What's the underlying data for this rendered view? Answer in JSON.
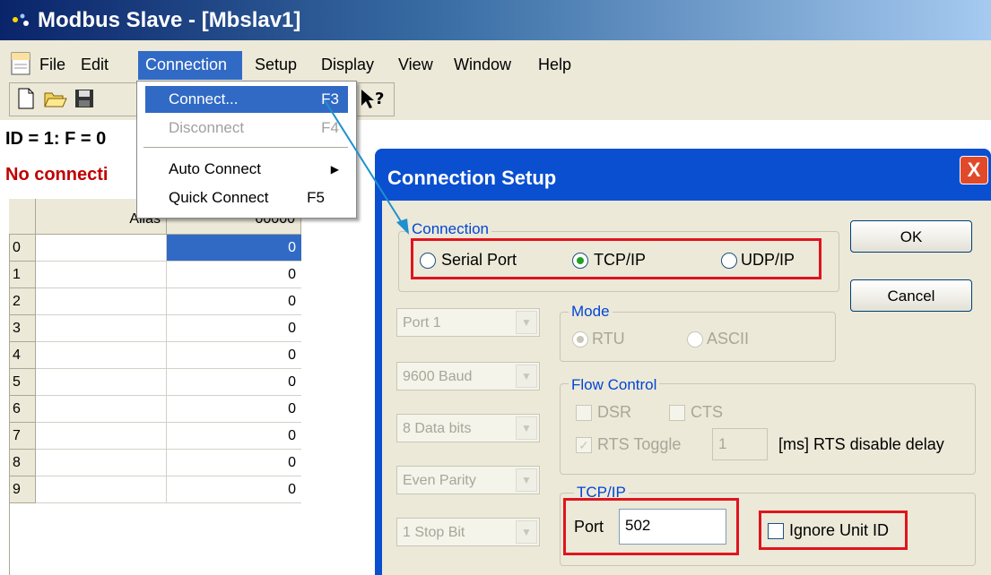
{
  "window": {
    "title": "Modbus Slave - [Mbslav1]"
  },
  "menubar": {
    "items": [
      "File",
      "Edit",
      "Connection",
      "Setup",
      "Display",
      "View",
      "Window",
      "Help"
    ]
  },
  "connection_menu": [
    {
      "label": "Connect...",
      "shortcut": "F3"
    },
    {
      "label": "Disconnect",
      "shortcut": "F4"
    },
    {
      "label": "Auto Connect",
      "shortcut": ""
    },
    {
      "label": "Quick Connect",
      "shortcut": "F5"
    }
  ],
  "status": {
    "id_line": "ID = 1: F = 0",
    "no_connection": "No connecti"
  },
  "grid": {
    "col_a_header": "Alias",
    "col_b_header": "00000",
    "row_numbers": [
      "0",
      "1",
      "2",
      "3",
      "4",
      "5",
      "6",
      "7",
      "8",
      "9"
    ],
    "values": [
      "0",
      "0",
      "0",
      "0",
      "0",
      "0",
      "0",
      "0",
      "0",
      "0"
    ]
  },
  "dialog": {
    "title": "Connection Setup",
    "close": "X",
    "ok_label": "OK",
    "cancel_label": "Cancel",
    "connection_group": "Connection",
    "conn_options": [
      "Serial Port",
      "TCP/IP",
      "UDP/IP"
    ],
    "conn_selected": "TCP/IP",
    "port_combo": "Port 1",
    "baud_combo": "9600 Baud",
    "databits_combo": "8 Data bits",
    "parity_combo": "Even Parity",
    "stopbit_combo": "1 Stop Bit",
    "mode_group": "Mode",
    "mode_rtu": "RTU",
    "mode_ascii": "ASCII",
    "flow_group": "Flow Control",
    "flow_dsr": "DSR",
    "flow_cts": "CTS",
    "flow_rts_toggle": "RTS Toggle",
    "rts_delay_value": "1",
    "rts_delay_label": "[ms] RTS disable delay",
    "tcpip_group": "TCP/IP",
    "port_label": "Port",
    "port_value": "502",
    "ignore_unit_id": "Ignore Unit ID"
  },
  "colors": {
    "highlight_red": "#e0141e",
    "menu_highlight": "#316ac5",
    "error_text": "#c00000"
  }
}
